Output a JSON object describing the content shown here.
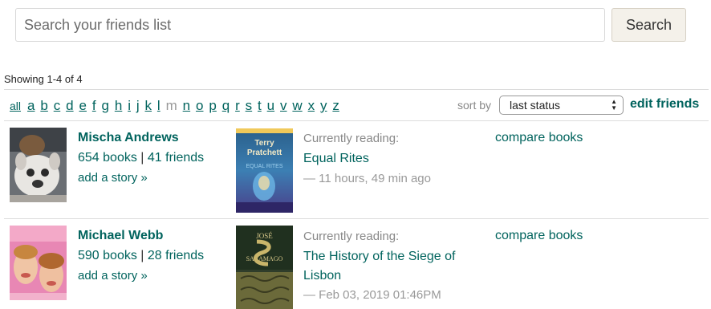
{
  "search": {
    "placeholder": "Search your friends list",
    "button_label": "Search"
  },
  "results": {
    "showing": "Showing 1-4 of 4"
  },
  "filter": {
    "all_label": "all",
    "letters": [
      {
        "l": "a",
        "on": true
      },
      {
        "l": "b",
        "on": true
      },
      {
        "l": "c",
        "on": true
      },
      {
        "l": "d",
        "on": true
      },
      {
        "l": "e",
        "on": true
      },
      {
        "l": "f",
        "on": true
      },
      {
        "l": "g",
        "on": true
      },
      {
        "l": "h",
        "on": true
      },
      {
        "l": "i",
        "on": true
      },
      {
        "l": "j",
        "on": true
      },
      {
        "l": "k",
        "on": true
      },
      {
        "l": "l",
        "on": true
      },
      {
        "l": "m",
        "on": false
      },
      {
        "l": "n",
        "on": true
      },
      {
        "l": "o",
        "on": true
      },
      {
        "l": "p",
        "on": true
      },
      {
        "l": "q",
        "on": true
      },
      {
        "l": "r",
        "on": true
      },
      {
        "l": "s",
        "on": true
      },
      {
        "l": "t",
        "on": true
      },
      {
        "l": "u",
        "on": true
      },
      {
        "l": "v",
        "on": true
      },
      {
        "l": "w",
        "on": true
      },
      {
        "l": "x",
        "on": true
      },
      {
        "l": "y",
        "on": true
      },
      {
        "l": "z",
        "on": true
      }
    ]
  },
  "sort": {
    "label": "sort by",
    "selected": "last status"
  },
  "edit_friends_label": "edit friends",
  "friends": [
    {
      "name": "Mischa Andrews",
      "books": "654 books",
      "friends": "41 friends",
      "story": "add a story »",
      "status_label": "Currently reading:",
      "book_title": "Equal Rites",
      "timestamp": "— 11 hours, 49 min ago",
      "compare": "compare books",
      "cover_text": {
        "author_line1": "Terry",
        "author_line2": "Pratchett",
        "title": "EQUAL RITES"
      }
    },
    {
      "name": "Michael Webb",
      "books": "590 books",
      "friends": "28 friends",
      "story": "add a story »",
      "status_label": "Currently reading:",
      "book_title": "The History of the Siege of Lisbon",
      "timestamp": "— Feb 03, 2019 01:46PM",
      "compare": "compare books",
      "cover_text": {
        "author_line1": "JOSÉ",
        "author_line2": "SARAMAGO"
      }
    }
  ],
  "colors": {
    "link": "#00635d",
    "muted": "#888888",
    "button_bg": "#f4f1ea"
  }
}
